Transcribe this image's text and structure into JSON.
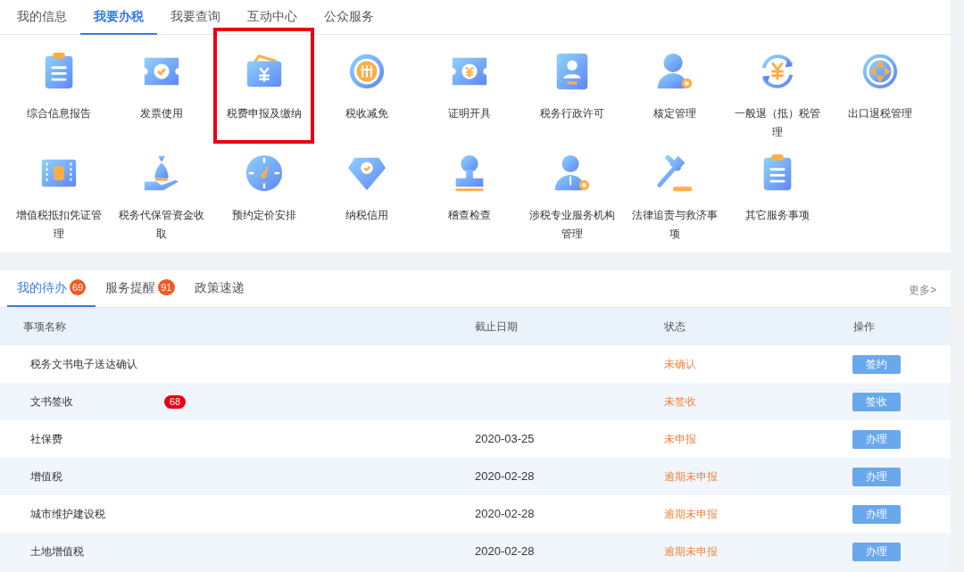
{
  "top_tabs": [
    {
      "label": "我的信息",
      "selected": false
    },
    {
      "label": "我要办税",
      "selected": true
    },
    {
      "label": "我要查询",
      "selected": false
    },
    {
      "label": "互动中心",
      "selected": false
    },
    {
      "label": "公众服务",
      "selected": false
    }
  ],
  "services": [
    {
      "label": "综合信息报告",
      "highlighted": false
    },
    {
      "label": "发票使用",
      "highlighted": false
    },
    {
      "label": "税费申报及缴纳",
      "highlighted": true
    },
    {
      "label": "税收减免",
      "highlighted": false
    },
    {
      "label": "证明开具",
      "highlighted": false
    },
    {
      "label": "税务行政许可",
      "highlighted": false
    },
    {
      "label": "核定管理",
      "highlighted": false
    },
    {
      "label": "一般退（抵）税管理",
      "highlighted": false
    },
    {
      "label": "出口退税管理",
      "highlighted": false
    },
    {
      "label": "增值税抵扣凭证管理",
      "highlighted": false
    },
    {
      "label": "税务代保管资金收取",
      "highlighted": false
    },
    {
      "label": "预约定价安排",
      "highlighted": false
    },
    {
      "label": "纳税信用",
      "highlighted": false
    },
    {
      "label": "稽查检查",
      "highlighted": false
    },
    {
      "label": "涉税专业服务机构管理",
      "highlighted": false
    },
    {
      "label": "法律追责与救济事项",
      "highlighted": false
    },
    {
      "label": "其它服务事项",
      "highlighted": false
    }
  ],
  "todo_tabs": [
    {
      "label": "我的待办",
      "badge": "69",
      "selected": true
    },
    {
      "label": "服务提醒",
      "badge": "91",
      "selected": false
    },
    {
      "label": "政策速递",
      "selected": false
    }
  ],
  "more_link": "更多>",
  "table": {
    "columns": [
      "事项名称",
      "截止日期",
      "状态",
      "操作"
    ],
    "rows": [
      {
        "name": "税务文书电子送达确认",
        "status": "未确认",
        "action": "签约"
      },
      {
        "name": "文书签收",
        "badge": "68",
        "status": "未签收",
        "action": "签收"
      },
      {
        "name": "社保费",
        "deadline": "2020-03-25",
        "status": "未申报",
        "action": "办理"
      },
      {
        "name": "增值税",
        "deadline": "2020-02-28",
        "status": "逾期未申报",
        "action": "办理"
      },
      {
        "name": "城市维护建设税",
        "deadline": "2020-02-28",
        "status": "逾期未申报",
        "action": "办理"
      },
      {
        "name": "土地增值税",
        "deadline": "2020-02-28",
        "status": "逾期未申报",
        "action": "办理"
      }
    ]
  }
}
